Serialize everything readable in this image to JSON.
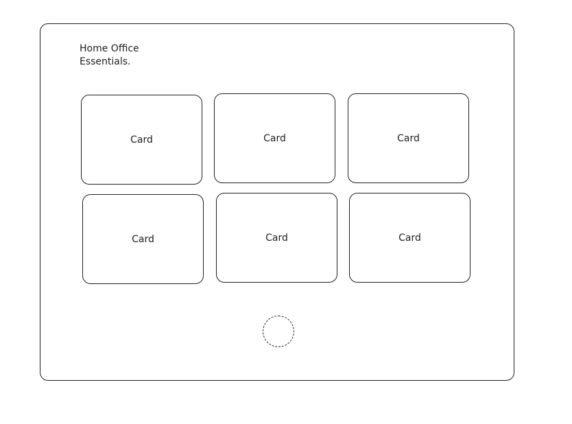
{
  "header": {
    "title": "Home Office\nEssentials."
  },
  "cards": [
    {
      "label": "Card"
    },
    {
      "label": "Card"
    },
    {
      "label": "Card"
    },
    {
      "label": "Card"
    },
    {
      "label": "Card"
    },
    {
      "label": "Card"
    }
  ],
  "loading_indicator": {
    "icon": "loading-spinner-icon"
  }
}
